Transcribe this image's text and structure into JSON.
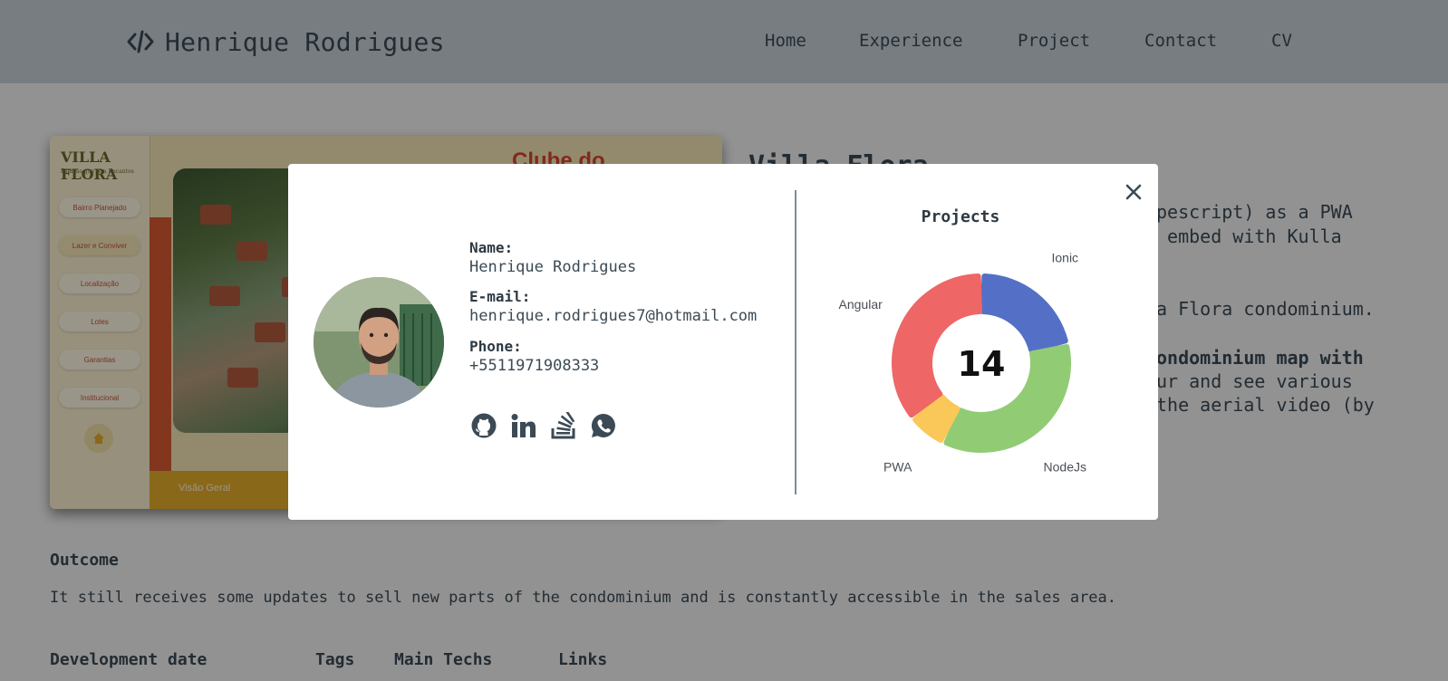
{
  "header": {
    "brand": "Henrique Rodrigues",
    "brand_icon": "code-icon",
    "nav": [
      "Home",
      "Experience",
      "Project",
      "Contact",
      "CV"
    ]
  },
  "background": {
    "project_title": "Villa Flora",
    "image": {
      "logo": "VILLA FLORA",
      "logo_sub": "Estação que tem Encantos",
      "menu": [
        "Bairro Planejado",
        "Lazer e Conviver",
        "Localização",
        "Lotes",
        "Garantias",
        "Institucional"
      ],
      "bottom_label": "Visão Geral",
      "headline": "Clube do"
    },
    "description_lines": [
      "pescript) as a PWA",
      " embed with Kulla",
      "a Flora condominium.",
      "ondominium map with",
      "ur and see various",
      "the aerial video (by"
    ],
    "outcome_title": "Outcome",
    "outcome_text": "It still receives some updates to sell new parts of the condominium and is constantly accessible in the sales area.",
    "meta_labels": [
      "Development date",
      "Tags",
      "Main Techs",
      "Links"
    ]
  },
  "modal": {
    "name_label": "Name:",
    "name_value": "Henrique Rodrigues",
    "email_label": "E-mail:",
    "email_value": "henrique.rodrigues7@hotmail.com",
    "phone_label": "Phone:",
    "phone_value": "+5511971908333",
    "social_icons": [
      "github-icon",
      "linkedin-icon",
      "stackoverflow-icon",
      "whatsapp-icon"
    ],
    "close_icon": "close-icon"
  },
  "chart_data": {
    "type": "pie",
    "title": "Projects",
    "center_value": "14",
    "slices": [
      {
        "label": "Ionic",
        "value": 3,
        "color": "#5470c6"
      },
      {
        "label": "NodeJs",
        "value": 5,
        "color": "#91cc75"
      },
      {
        "label": "PWA",
        "value": 1,
        "color": "#fac858"
      },
      {
        "label": "Angular",
        "value": 5,
        "color": "#ee6666"
      }
    ]
  }
}
